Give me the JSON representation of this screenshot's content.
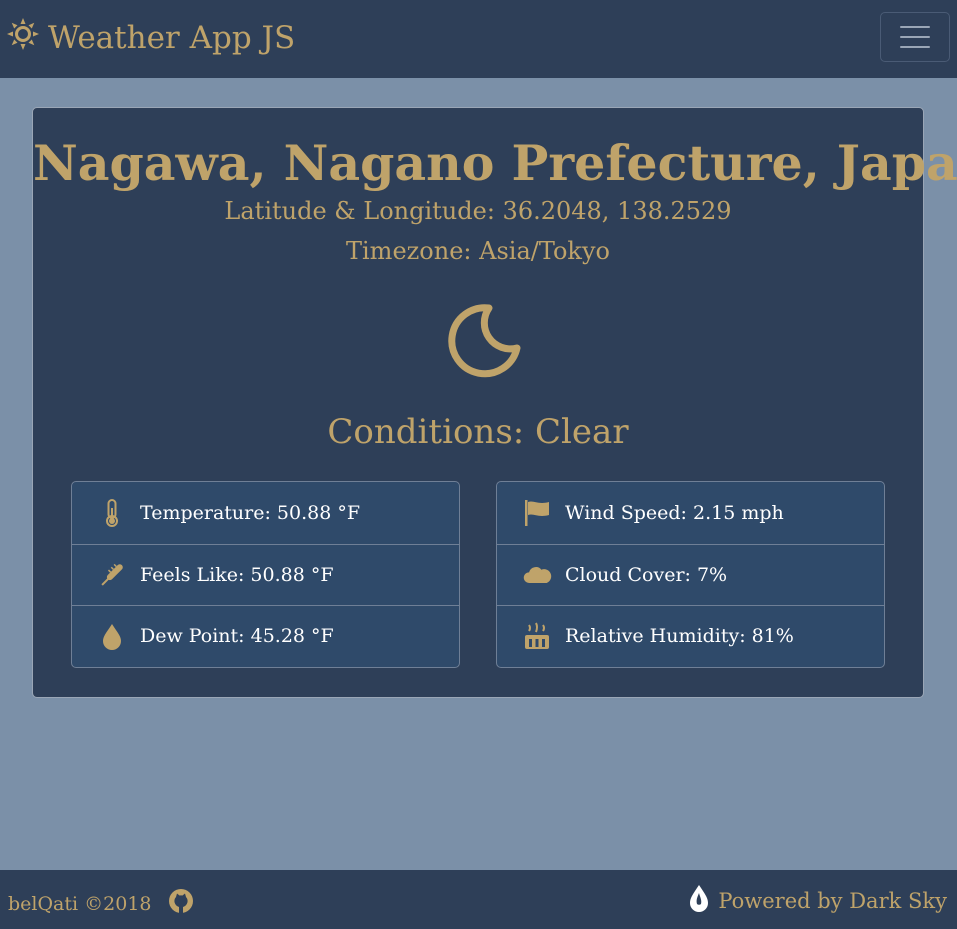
{
  "navbar": {
    "brand_label": "Weather App JS",
    "brand_icon": "sun-icon",
    "menu_icon": "hamburger-menu-icon"
  },
  "weather": {
    "location": "Nagawa, Nagano Prefecture, Japan",
    "coordinates": "Latitude & Longitude: 36.2048, 138.2529",
    "timezone": "Timezone: Asia/Tokyo",
    "condition_icon": "moon-icon",
    "conditions": "Conditions: Clear",
    "left_list": [
      {
        "icon": "thermometer-icon",
        "text": "Temperature: 50.88 °F"
      },
      {
        "icon": "feels-like-thermometer-icon",
        "text": "Feels Like: 50.88 °F"
      },
      {
        "icon": "droplet-icon",
        "text": "Dew Point: 45.28 °F"
      }
    ],
    "right_list": [
      {
        "icon": "flag-icon",
        "text": "Wind Speed: 2.15 mph"
      },
      {
        "icon": "cloud-icon",
        "text": "Cloud Cover: 7%"
      },
      {
        "icon": "humidity-icon",
        "text": "Relative Humidity: 81%"
      }
    ]
  },
  "footer": {
    "credit": "belQati ©2018",
    "github_icon": "github-icon",
    "powered_by": "Powered by Dark Sky",
    "darksky_icon": "dark-sky-icon"
  },
  "colors": {
    "page_background": "#7b90a8",
    "panel": "#2e3f58",
    "list_background": "#2f4a6a",
    "accent": "#bfa36a",
    "text": "#ffffff"
  }
}
